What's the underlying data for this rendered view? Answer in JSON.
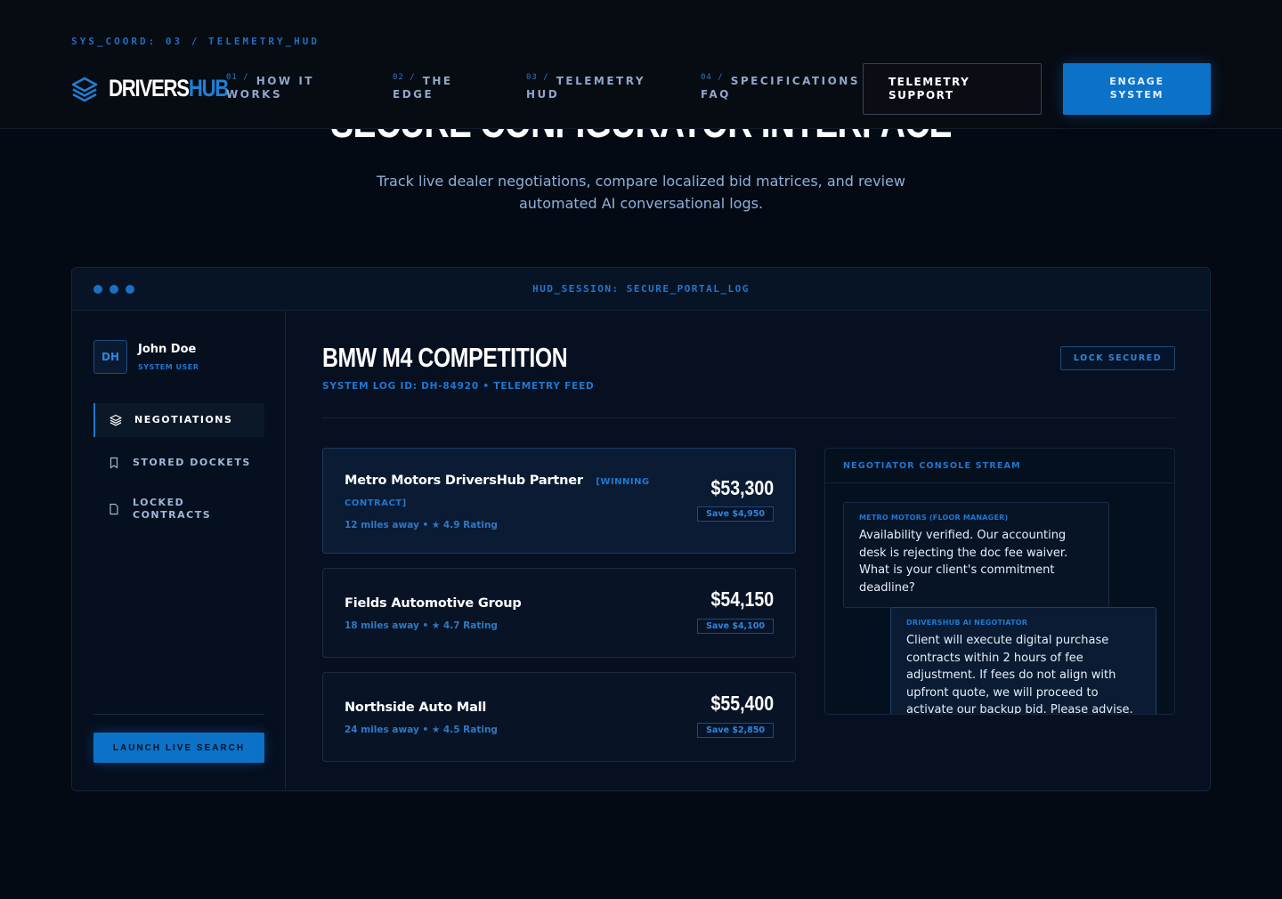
{
  "header": {
    "sys_coord": "SYS_COORD: 03 / TELEMETRY_HUD",
    "logo_part1": "DRIVERS",
    "logo_part2": "HUB",
    "nav": [
      {
        "num": "01 /",
        "line1": "HOW IT",
        "line2": "WORKS"
      },
      {
        "num": "02 /",
        "line1": "THE",
        "line2": "EDGE"
      },
      {
        "num": "03 /",
        "line1": "TELEMETRY",
        "line2": "HUD"
      },
      {
        "num": "04 /",
        "line1": "SPECIFICATIONS",
        "line2": "FAQ"
      }
    ],
    "support_line1": "TELEMETRY",
    "support_line2": "SUPPORT",
    "engage_line1": "ENGAGE",
    "engage_line2": "SYSTEM"
  },
  "hero": {
    "title": "SECURE CONFIGURATOR INTERFACE",
    "subtitle": "Track live dealer negotiations, compare localized bid matrices, and review automated AI conversational logs."
  },
  "window": {
    "title": "HUD_SESSION: SECURE_PORTAL_LOG"
  },
  "sidebar": {
    "avatar": "DH",
    "user_name": "John Doe",
    "user_role": "SYSTEM USER",
    "items": [
      {
        "label_line1": "NEGOTIATIONS",
        "label_line2": "",
        "icon": "layers-icon"
      },
      {
        "label_line1": "STORED DOCKETS",
        "label_line2": "",
        "icon": "bookmark-icon"
      },
      {
        "label_line1": "LOCKED",
        "label_line2": "CONTRACTS",
        "icon": "document-icon"
      }
    ],
    "launch_label": "LAUNCH LIVE SEARCH"
  },
  "main": {
    "car_title": "BMW M4 COMPETITION",
    "log_id": "SYSTEM LOG ID: DH-84920 • TELEMETRY FEED",
    "lock_badge": "LOCK SECURED",
    "offers": [
      {
        "name": "Metro Motors DriversHub Partner",
        "tag_line1": "[WINNING",
        "tag_line2": "CONTRACT]",
        "meta": "12 miles away • ★ 4.9 Rating",
        "price": "$53,300",
        "save": "Save $4,950"
      },
      {
        "name": "Fields Automotive Group",
        "meta": "18 miles away • ★ 4.7 Rating",
        "price": "$54,150",
        "save": "Save $4,100"
      },
      {
        "name": "Northside Auto Mall",
        "meta": "24 miles away • ★ 4.5 Rating",
        "price": "$55,400",
        "save": "Save $2,850"
      }
    ]
  },
  "console": {
    "title": "NEGOTIATOR CONSOLE STREAM",
    "messages": [
      {
        "who": "METRO MOTORS (FLOOR MANAGER)",
        "text": "Availability verified. Our accounting desk is rejecting the doc fee waiver. What is your client's commitment deadline?"
      },
      {
        "who": "DRIVERSHUB AI NEGOTIATOR",
        "text": "Client will execute digital purchase contracts within 2 hours of fee adjustment. If fees do not align with upfront quote, we will proceed to activate our backup bid. Please advise."
      }
    ]
  },
  "colors": {
    "background": "#040a14",
    "accent": "#1f78d0",
    "button": "#0c72c7"
  }
}
